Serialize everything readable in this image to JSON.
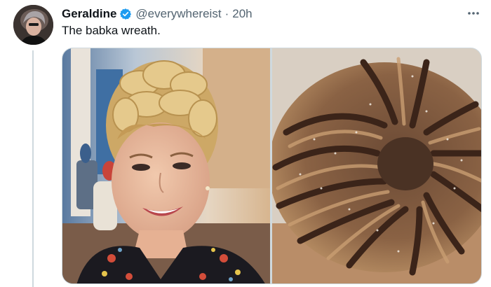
{
  "tweet": {
    "author_name": "Geraldine",
    "handle": "@everywhereist",
    "separator": "·",
    "time": "20h",
    "text": "The babka wreath.",
    "more_icon": "more-horizontal-icon",
    "verified_icon": "verified-badge-icon"
  },
  "colors": {
    "text_primary": "#0f1419",
    "text_secondary": "#536471",
    "verified_blue": "#1d9bf0",
    "border": "#cfd9de"
  },
  "media": {
    "count": 2
  }
}
